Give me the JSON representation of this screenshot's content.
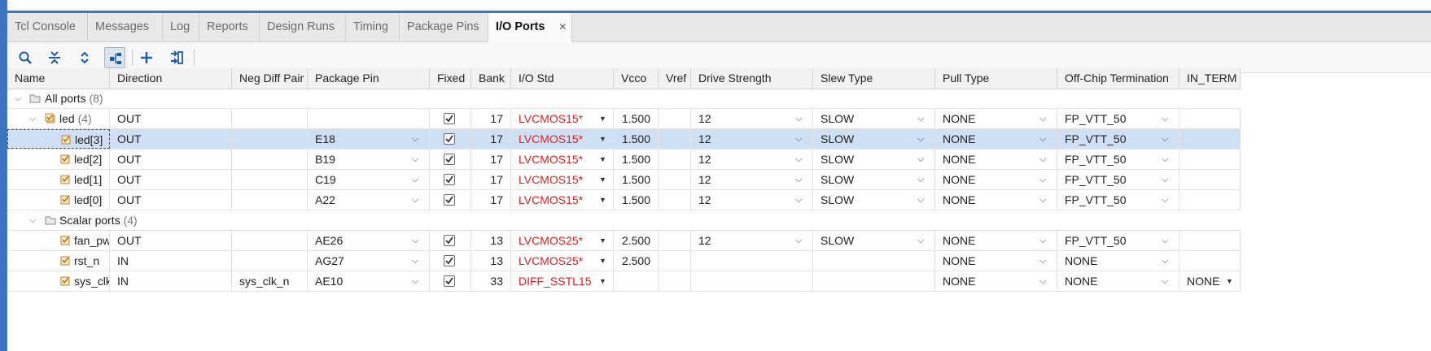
{
  "tabs": [
    {
      "label": "Tcl Console",
      "active": false
    },
    {
      "label": "Messages",
      "active": false
    },
    {
      "label": "Log",
      "active": false
    },
    {
      "label": "Reports",
      "active": false
    },
    {
      "label": "Design Runs",
      "active": false
    },
    {
      "label": "Timing",
      "active": false
    },
    {
      "label": "Package Pins",
      "active": false
    },
    {
      "label": "I/O Ports",
      "active": true,
      "close_icon": "close-icon"
    }
  ],
  "toolbar": {
    "buttons": [
      "search-icon",
      "collapse-all-icon",
      "expand-all-icon",
      "group-by-interface-icon",
      "add-icon",
      "export-icon"
    ]
  },
  "columns": [
    "Name",
    "Direction",
    "Neg Diff Pair",
    "Package Pin",
    "Fixed",
    "Bank",
    "I/O Std",
    "Vcco",
    "Vref",
    "Drive Strength",
    "Slew Type",
    "Pull Type",
    "Off-Chip Termination",
    "IN_TERM"
  ],
  "groups": {
    "all_ports": {
      "label": "All ports",
      "count": "(8)"
    },
    "led": {
      "label": "led",
      "count": "(4)",
      "direction": "OUT",
      "fixed": true,
      "bank": "17",
      "io_std": "LVCMOS15*",
      "vcco": "1.500",
      "drive": "12",
      "slew": "SLOW",
      "pull": "NONE",
      "offchip": "FP_VTT_50"
    },
    "scalar": {
      "label": "Scalar ports",
      "count": "(4)"
    }
  },
  "rows": [
    {
      "name": "led[3]",
      "direction": "OUT",
      "neg": "",
      "pin": "E18",
      "fixed": true,
      "bank": "17",
      "io_std": "LVCMOS15*",
      "vcco": "1.500",
      "vref": "",
      "drive": "12",
      "slew": "SLOW",
      "pull": "NONE",
      "offchip": "FP_VTT_50",
      "interm": "",
      "selected": true
    },
    {
      "name": "led[2]",
      "direction": "OUT",
      "neg": "",
      "pin": "B19",
      "fixed": true,
      "bank": "17",
      "io_std": "LVCMOS15*",
      "vcco": "1.500",
      "vref": "",
      "drive": "12",
      "slew": "SLOW",
      "pull": "NONE",
      "offchip": "FP_VTT_50",
      "interm": "",
      "selected": false
    },
    {
      "name": "led[1]",
      "direction": "OUT",
      "neg": "",
      "pin": "C19",
      "fixed": true,
      "bank": "17",
      "io_std": "LVCMOS15*",
      "vcco": "1.500",
      "vref": "",
      "drive": "12",
      "slew": "SLOW",
      "pull": "NONE",
      "offchip": "FP_VTT_50",
      "interm": "",
      "selected": false
    },
    {
      "name": "led[0]",
      "direction": "OUT",
      "neg": "",
      "pin": "A22",
      "fixed": true,
      "bank": "17",
      "io_std": "LVCMOS15*",
      "vcco": "1.500",
      "vref": "",
      "drive": "12",
      "slew": "SLOW",
      "pull": "NONE",
      "offchip": "FP_VTT_50",
      "interm": "",
      "selected": false
    },
    {
      "name": "fan_pwm",
      "direction": "OUT",
      "neg": "",
      "pin": "AE26",
      "fixed": true,
      "bank": "13",
      "io_std": "LVCMOS25*",
      "vcco": "2.500",
      "vref": "",
      "drive": "12",
      "slew": "SLOW",
      "pull": "NONE",
      "offchip": "FP_VTT_50",
      "interm": "",
      "selected": false
    },
    {
      "name": "rst_n",
      "direction": "IN",
      "neg": "",
      "pin": "AG27",
      "fixed": true,
      "bank": "13",
      "io_std": "LVCMOS25*",
      "vcco": "2.500",
      "vref": "",
      "drive": "",
      "slew": "",
      "pull": "NONE",
      "offchip": "NONE",
      "interm": "",
      "selected": false
    },
    {
      "name": "sys_clk_p",
      "direction": "IN",
      "neg": "sys_clk_n",
      "pin": "AE10",
      "fixed": true,
      "bank": "33",
      "io_std": "DIFF_SSTL15",
      "vcco": "",
      "vref": "",
      "drive": "",
      "slew": "",
      "pull": "NONE",
      "offchip": "NONE",
      "interm": "NONE",
      "selected": false
    }
  ],
  "colors": {
    "accent": "#3f74c0",
    "selected_row": "#cfe0f4",
    "io_std_text": "#e02020"
  }
}
